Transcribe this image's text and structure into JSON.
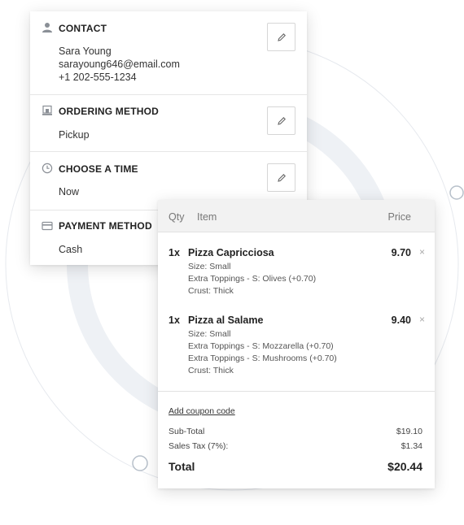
{
  "colors": {
    "accent_ring": "#e9edf2",
    "thin_ring": "#e6e9ee",
    "node_border": "#b7c0ca"
  },
  "contact": {
    "icon": "person-icon",
    "title": "CONTACT",
    "name": "Sara Young",
    "email": "sarayoung646@email.com",
    "phone": "+1 202-555-1234",
    "edit_icon": "pencil-icon"
  },
  "ordering_method": {
    "icon": "storefront-icon",
    "title": "ORDERING METHOD",
    "value": "Pickup",
    "edit_icon": "pencil-icon"
  },
  "time": {
    "icon": "clock-icon",
    "title": "CHOOSE A TIME",
    "value": "Now",
    "edit_icon": "pencil-icon"
  },
  "payment": {
    "icon": "credit-card-icon",
    "title": "PAYMENT METHOD",
    "value": "Cash"
  },
  "order": {
    "headers": {
      "qty": "Qty",
      "item": "Item",
      "price": "Price"
    },
    "items": [
      {
        "qty": "1x",
        "name": "Pizza Capricciosa",
        "price": "9.70",
        "remove": "×",
        "details": [
          "Size: Small",
          "Extra Toppings - S: Olives (+0.70)",
          "Crust: Thick"
        ]
      },
      {
        "qty": "1x",
        "name": "Pizza al Salame",
        "price": "9.40",
        "remove": "×",
        "details": [
          "Size: Small",
          "Extra Toppings - S: Mozzarella (+0.70)",
          "Extra Toppings - S: Mushrooms (+0.70)",
          "Crust: Thick"
        ]
      }
    ],
    "coupon": "Add coupon code",
    "subtotal": {
      "label": "Sub-Total",
      "value": "$19.10"
    },
    "tax": {
      "label": "Sales Tax (7%):",
      "value": "$1.34"
    },
    "total": {
      "label": "Total",
      "value": "$20.44"
    }
  }
}
